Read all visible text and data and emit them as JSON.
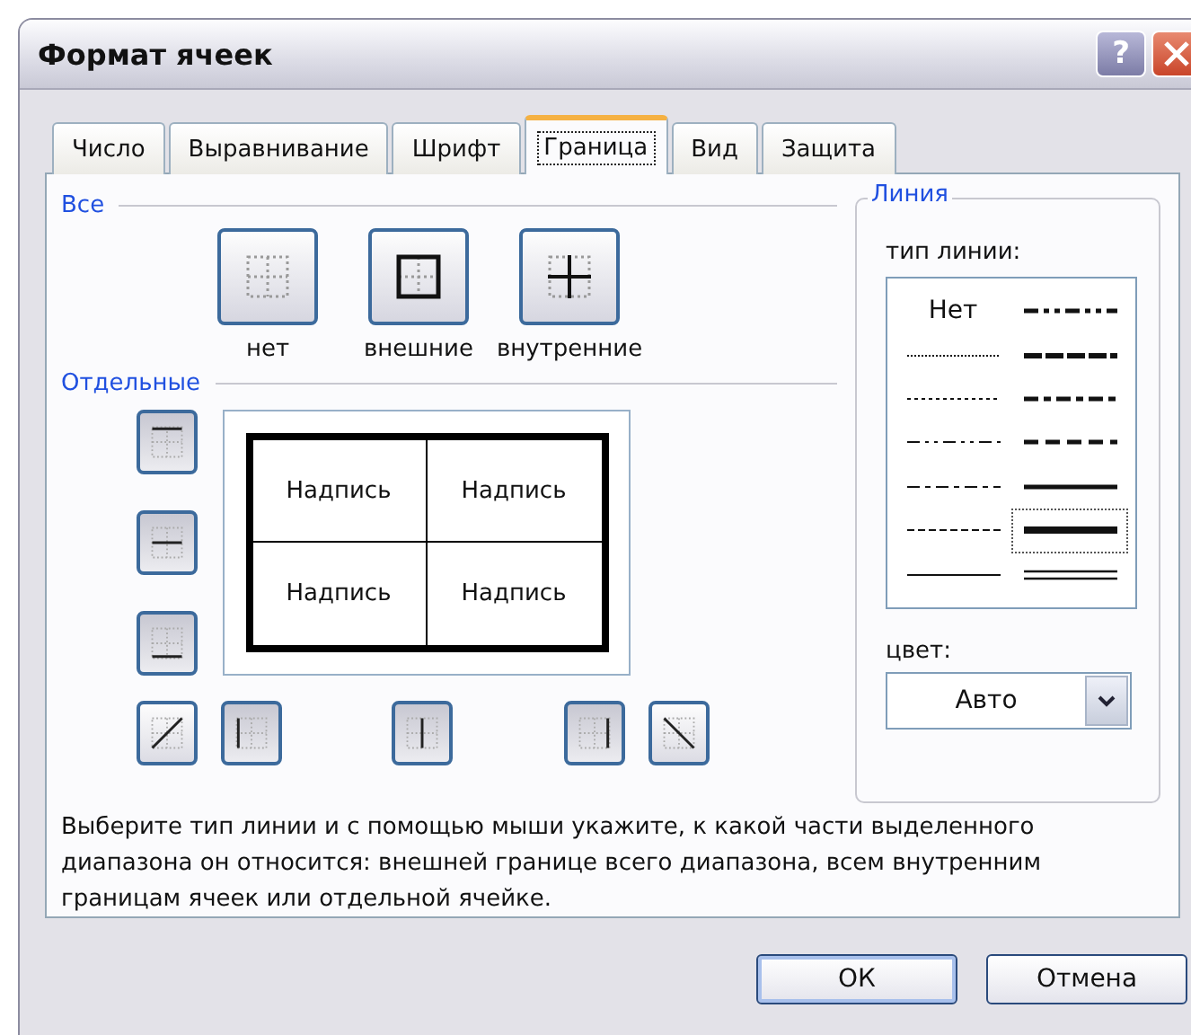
{
  "window": {
    "title": "Формат ячеек",
    "help_button": "?"
  },
  "tabs": [
    {
      "label": "Число",
      "selected": false
    },
    {
      "label": "Выравнивание",
      "selected": false
    },
    {
      "label": "Шрифт",
      "selected": false
    },
    {
      "label": "Граница",
      "selected": true
    },
    {
      "label": "Вид",
      "selected": false
    },
    {
      "label": "Защита",
      "selected": false
    }
  ],
  "presets": {
    "title": "Все",
    "items": [
      {
        "kind": "none",
        "label": "нет"
      },
      {
        "kind": "outline",
        "label": "внешние"
      },
      {
        "kind": "inside",
        "label": "внутренние"
      }
    ]
  },
  "border": {
    "title": "Отдельные",
    "side_buttons": [
      {
        "kind": "top",
        "pressed": true
      },
      {
        "kind": "middle-h",
        "pressed": true
      },
      {
        "kind": "bottom",
        "pressed": true
      }
    ],
    "bottom_buttons": [
      {
        "kind": "diag-up",
        "pressed": false
      },
      {
        "kind": "left",
        "pressed": true
      },
      {
        "kind": "middle-v",
        "pressed": true
      },
      {
        "kind": "right",
        "pressed": true
      },
      {
        "kind": "diag-down",
        "pressed": false
      }
    ],
    "preview_cells": [
      "Надпись",
      "Надпись",
      "Надпись",
      "Надпись"
    ]
  },
  "line": {
    "title": "Линия",
    "style_label": "тип линии:",
    "styles": [
      {
        "kind": "none",
        "label": "Нет",
        "selected": false
      },
      {
        "kind": "hair",
        "selected": false
      },
      {
        "kind": "dotted",
        "selected": false
      },
      {
        "kind": "dash-dot-dot",
        "selected": false
      },
      {
        "kind": "dash-dot",
        "selected": false
      },
      {
        "kind": "dashed",
        "selected": false
      },
      {
        "kind": "thin",
        "selected": false
      },
      {
        "kind": "medium-dash-dot-dot",
        "selected": false
      },
      {
        "kind": "slanted",
        "selected": false
      },
      {
        "kind": "medium-dash-dot",
        "selected": false
      },
      {
        "kind": "medium-dashed",
        "selected": false
      },
      {
        "kind": "medium",
        "selected": false
      },
      {
        "kind": "thick",
        "selected": true
      },
      {
        "kind": "double",
        "selected": false
      }
    ],
    "color_label": "цвет:",
    "color_value": "Авто"
  },
  "description": "Выберите тип линии и с помощью мыши укажите, к какой части выделенного диапазона он относится: внешней границе всего диапазона, всем внутренним границам ячеек или отдельной ячейке.",
  "buttons": [
    "ОК",
    "Отмена"
  ]
}
